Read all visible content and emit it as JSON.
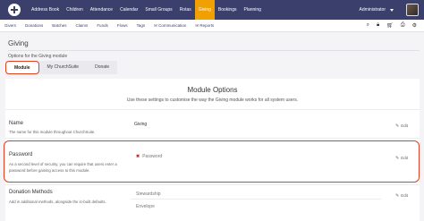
{
  "topnav": {
    "items": [
      "Address Book",
      "Children",
      "Attendance",
      "Calendar",
      "Small Groups",
      "Rotas",
      "Giving",
      "Bookings",
      "Planning"
    ],
    "active": "Giving",
    "user": "Administrator"
  },
  "subnav": {
    "items": [
      "Givers",
      "Donations",
      "Batches",
      "Claims",
      "Funds",
      "Flows",
      "Tags",
      "✉ Communication",
      "✉ Reports"
    ]
  },
  "page": {
    "heading": "Giving",
    "subtitle": "Options for the Giving module"
  },
  "tabs": [
    "Module",
    "My ChurchSuite",
    "Donate"
  ],
  "module_options": {
    "title": "Module Options",
    "description": "Use these settings to customise the way the Giving module works for all system users."
  },
  "rows": {
    "name": {
      "title": "Name",
      "description": "The name for this module throughout ChurchSuite.",
      "value": "Giving",
      "edit": "Edit"
    },
    "password": {
      "title": "Password",
      "description_line1": "As a second level of security, you can require that users enter a",
      "description_line2": "password before gaining access to this module.",
      "value": "Password",
      "edit": "Edit"
    },
    "donation_methods": {
      "title": "Donation Methods",
      "description": "Add in additional methods, alongside the in-built defaults.",
      "values": [
        "Stewardship",
        "Envelope"
      ],
      "edit": "Edit"
    }
  },
  "icons": {
    "subnav": [
      "search-icon",
      "lock-icon",
      "cart-icon",
      "print-icon",
      "gear-icon"
    ],
    "edit": "pencil-icon"
  },
  "colors": {
    "nav": "#3b3f6b",
    "active": "#f0a000",
    "highlight": "#e04020"
  }
}
